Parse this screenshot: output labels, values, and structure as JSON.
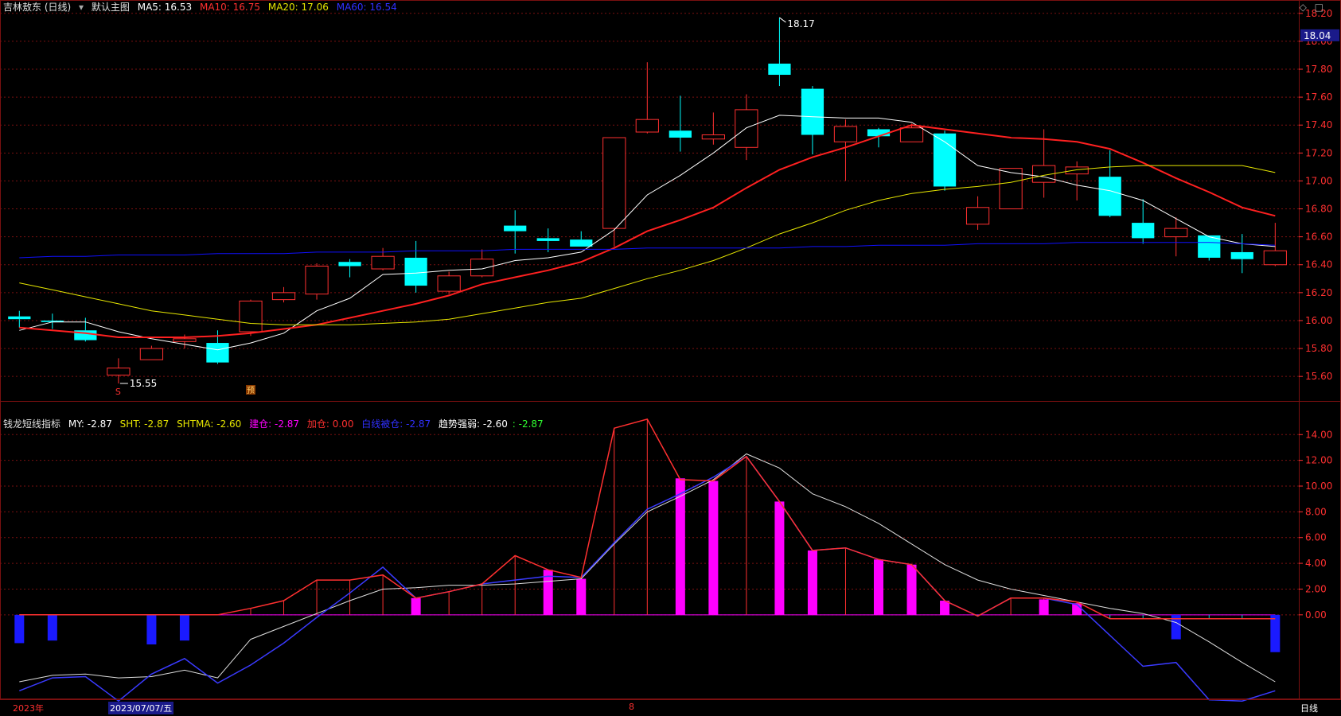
{
  "main_header": {
    "stock_name": "吉林敖东 (日线)",
    "template": "默认主图",
    "ma5": "MA5: 16.53",
    "ma10": "MA10: 16.75",
    "ma20": "MA20: 17.06",
    "ma60": "MA60: 16.54"
  },
  "indicator_header": {
    "name": "钱龙短线指标",
    "my": "MY: -2.87",
    "sht": "SHT: -2.87",
    "shtma": "SHTMA: -2.60",
    "jiancang": "建仓: -2.87",
    "jiacang": "加仓: 0.00",
    "bailang": "白线被仓: -2.87",
    "trend_label": "趋势强弱: -2.60",
    "trend_extra": ": -2.87"
  },
  "current_price_tag": "18.04",
  "high_annotation": "18.17",
  "low_annotation": "15.55",
  "marker_s": "S",
  "marker_box": "预",
  "bottom_bar": {
    "year_label": "2023年",
    "date_label": "2023/07/07/五",
    "month_label": "8",
    "period_label": "日线"
  },
  "colors": {
    "background": "#000000",
    "grid": "#7a1010",
    "up": "#ff3030",
    "down": "#00ffff",
    "ma5": "#ffffff",
    "ma10": "#ff2020",
    "ma20": "#e6e600",
    "ma60": "#1010ff",
    "magenta": "#ff00ff",
    "blue_bar": "#1a1aff"
  },
  "chart_data": [
    {
      "type": "candlestick",
      "yticks": [
        "18.20",
        "18.00",
        "17.80",
        "17.60",
        "17.40",
        "17.20",
        "17.00",
        "16.80",
        "16.60",
        "16.40",
        "16.20",
        "16.00",
        "15.80",
        "15.60"
      ],
      "ylim": [
        15.47,
        18.25
      ],
      "candles": [
        {
          "o": 16.03,
          "c": 16.01,
          "h": 16.07,
          "l": 15.95
        },
        {
          "o": 16.0,
          "c": 15.99,
          "h": 16.05,
          "l": 15.94
        },
        {
          "o": 15.93,
          "c": 15.86,
          "h": 16.02,
          "l": 15.85
        },
        {
          "o": 15.61,
          "c": 15.66,
          "h": 15.73,
          "l": 15.55
        },
        {
          "o": 15.72,
          "c": 15.8,
          "h": 15.82,
          "l": 15.72
        },
        {
          "o": 15.85,
          "c": 15.87,
          "h": 15.9,
          "l": 15.8
        },
        {
          "o": 15.84,
          "c": 15.7,
          "h": 15.93,
          "l": 15.69
        },
        {
          "o": 15.92,
          "c": 16.14,
          "h": 16.15,
          "l": 15.89
        },
        {
          "o": 16.15,
          "c": 16.2,
          "h": 16.24,
          "l": 16.13
        },
        {
          "o": 16.19,
          "c": 16.39,
          "h": 16.41,
          "l": 16.15
        },
        {
          "o": 16.42,
          "c": 16.39,
          "h": 16.44,
          "l": 16.31
        },
        {
          "o": 16.37,
          "c": 16.46,
          "h": 16.52,
          "l": 16.36
        },
        {
          "o": 16.45,
          "c": 16.25,
          "h": 16.57,
          "l": 16.2
        },
        {
          "o": 16.21,
          "c": 16.32,
          "h": 16.35,
          "l": 16.19
        },
        {
          "o": 16.32,
          "c": 16.44,
          "h": 16.51,
          "l": 16.31
        },
        {
          "o": 16.68,
          "c": 16.64,
          "h": 16.79,
          "l": 16.48
        },
        {
          "o": 16.59,
          "c": 16.57,
          "h": 16.66,
          "l": 16.49
        },
        {
          "o": 16.58,
          "c": 16.53,
          "h": 16.64,
          "l": 16.53
        },
        {
          "o": 16.66,
          "c": 17.31,
          "h": 17.31,
          "l": 16.53
        },
        {
          "o": 17.35,
          "c": 17.44,
          "h": 17.85,
          "l": 17.34
        },
        {
          "o": 17.36,
          "c": 17.31,
          "h": 17.61,
          "l": 17.21
        },
        {
          "o": 17.3,
          "c": 17.33,
          "h": 17.49,
          "l": 17.26
        },
        {
          "o": 17.24,
          "c": 17.51,
          "h": 17.62,
          "l": 17.15
        },
        {
          "o": 17.84,
          "c": 17.76,
          "h": 18.17,
          "l": 17.68
        },
        {
          "o": 17.66,
          "c": 17.33,
          "h": 17.68,
          "l": 17.19
        },
        {
          "o": 17.28,
          "c": 17.39,
          "h": 17.44,
          "l": 17.0
        },
        {
          "o": 17.37,
          "c": 17.32,
          "h": 17.38,
          "l": 17.24
        },
        {
          "o": 17.28,
          "c": 17.38,
          "h": 17.41,
          "l": 17.28
        },
        {
          "o": 17.34,
          "c": 16.96,
          "h": 17.36,
          "l": 16.93
        },
        {
          "o": 16.69,
          "c": 16.81,
          "h": 16.89,
          "l": 16.65
        },
        {
          "o": 16.8,
          "c": 17.09,
          "h": 17.09,
          "l": 16.8
        },
        {
          "o": 16.99,
          "c": 17.11,
          "h": 17.37,
          "l": 16.88
        },
        {
          "o": 17.05,
          "c": 17.1,
          "h": 17.14,
          "l": 16.86
        },
        {
          "o": 17.03,
          "c": 16.75,
          "h": 17.22,
          "l": 16.74
        },
        {
          "o": 16.7,
          "c": 16.59,
          "h": 16.87,
          "l": 16.55
        },
        {
          "o": 16.6,
          "c": 16.66,
          "h": 16.74,
          "l": 16.46
        },
        {
          "o": 16.61,
          "c": 16.45,
          "h": 16.61,
          "l": 16.43
        },
        {
          "o": 16.49,
          "c": 16.44,
          "h": 16.62,
          "l": 16.34
        },
        {
          "o": 16.4,
          "c": 16.5,
          "h": 16.7,
          "l": 16.39
        }
      ],
      "series": [
        {
          "name": "MA5",
          "values": [
            15.93,
            15.99,
            15.99,
            15.92,
            15.87,
            15.83,
            15.79,
            15.84,
            15.91,
            16.07,
            16.16,
            16.33,
            16.34,
            16.36,
            16.37,
            16.43,
            16.45,
            16.49,
            16.65,
            16.9,
            17.04,
            17.2,
            17.38,
            17.47,
            17.46,
            17.45,
            17.45,
            17.42,
            17.28,
            17.11,
            17.06,
            17.03,
            16.97,
            16.93,
            16.86,
            16.73,
            16.6,
            16.55,
            16.53
          ]
        },
        {
          "name": "MA10",
          "values": [
            15.95,
            15.93,
            15.91,
            15.88,
            15.88,
            15.88,
            15.89,
            15.91,
            15.94,
            15.97,
            16.02,
            16.07,
            16.12,
            16.18,
            16.26,
            16.31,
            16.36,
            16.42,
            16.52,
            16.64,
            16.72,
            16.81,
            16.95,
            17.08,
            17.17,
            17.24,
            17.32,
            17.4,
            17.37,
            17.34,
            17.31,
            17.3,
            17.28,
            17.23,
            17.13,
            17.02,
            16.92,
            16.81,
            16.75
          ]
        },
        {
          "name": "MA20",
          "values": [
            16.27,
            16.22,
            16.17,
            16.12,
            16.07,
            16.04,
            16.01,
            15.98,
            15.97,
            15.97,
            15.97,
            15.98,
            15.99,
            16.01,
            16.05,
            16.09,
            16.13,
            16.16,
            16.23,
            16.3,
            16.36,
            16.43,
            16.52,
            16.62,
            16.7,
            16.79,
            16.86,
            16.91,
            16.94,
            16.96,
            16.99,
            17.04,
            17.08,
            17.1,
            17.11,
            17.11,
            17.11,
            17.11,
            17.06
          ]
        },
        {
          "name": "MA60",
          "values": [
            16.45,
            16.46,
            16.46,
            16.47,
            16.47,
            16.47,
            16.48,
            16.48,
            16.48,
            16.49,
            16.49,
            16.49,
            16.5,
            16.5,
            16.5,
            16.51,
            16.51,
            16.51,
            16.51,
            16.52,
            16.52,
            16.52,
            16.52,
            16.52,
            16.53,
            16.53,
            16.54,
            16.54,
            16.54,
            16.55,
            16.55,
            16.55,
            16.56,
            16.56,
            16.56,
            16.56,
            16.56,
            16.55,
            16.54
          ]
        }
      ]
    },
    {
      "type": "line",
      "yticks": [
        "14.00",
        "12.00",
        "10.00",
        "8.00",
        "6.00",
        "4.00",
        "2.00",
        "0.00"
      ],
      "ylim": [
        -6.5,
        15.5
      ],
      "series": [
        {
          "name": "MY",
          "values": [
            0,
            0,
            0,
            0,
            0,
            0,
            0,
            0.5,
            1.1,
            2.7,
            2.7,
            3.1,
            1.3,
            1.8,
            2.4,
            4.6,
            3.5,
            2.9,
            14.5,
            15.2,
            10.5,
            10.4,
            12.3,
            8.8,
            5.0,
            5.2,
            4.3,
            3.9,
            1.1,
            -0.1,
            1.3,
            1.3,
            1.0,
            -0.3,
            -0.3,
            -0.3,
            -0.3,
            -0.3,
            -0.3
          ]
        },
        {
          "name": "SHT",
          "values": [
            -5.9,
            -4.9,
            -4.8,
            -6.7,
            -4.6,
            -3.4,
            -5.3,
            -3.9,
            -2.2,
            -0.2,
            1.7,
            3.7,
            1.3,
            1.8,
            2.4,
            2.7,
            3.0,
            2.9,
            5.6,
            8.2,
            9.4,
            10.7,
            12.3,
            8.8,
            5.0,
            5.2,
            4.3,
            3.9,
            1.1,
            -0.1,
            1.3,
            1.3,
            0.8,
            -1.6,
            -4.0,
            -3.7,
            -6.6,
            -6.7,
            -5.9
          ]
        },
        {
          "name": "SHTMA",
          "values": [
            -5.2,
            -4.7,
            -4.6,
            -4.9,
            -4.8,
            -4.3,
            -4.9,
            -1.9,
            -0.9,
            0.1,
            1.1,
            2.0,
            2.1,
            2.3,
            2.3,
            2.4,
            2.6,
            2.8,
            5.5,
            8.0,
            9.2,
            10.5,
            12.5,
            11.4,
            9.4,
            8.4,
            7.1,
            5.5,
            3.9,
            2.7,
            2.0,
            1.5,
            1.0,
            0.5,
            0.1,
            -0.6,
            -2.1,
            -3.7,
            -5.2
          ]
        }
      ],
      "bars": [
        -2.2,
        -2.0,
        0,
        0,
        -2.3,
        -2.0,
        0,
        0,
        0,
        0,
        0,
        0,
        1.3,
        0,
        0,
        0,
        3.5,
        2.8,
        0,
        0,
        10.6,
        10.4,
        0,
        8.8,
        5.0,
        0,
        4.3,
        3.9,
        1.1,
        0,
        0,
        1.2,
        0.9,
        0,
        0,
        -1.9,
        0,
        0,
        -2.9
      ]
    }
  ]
}
